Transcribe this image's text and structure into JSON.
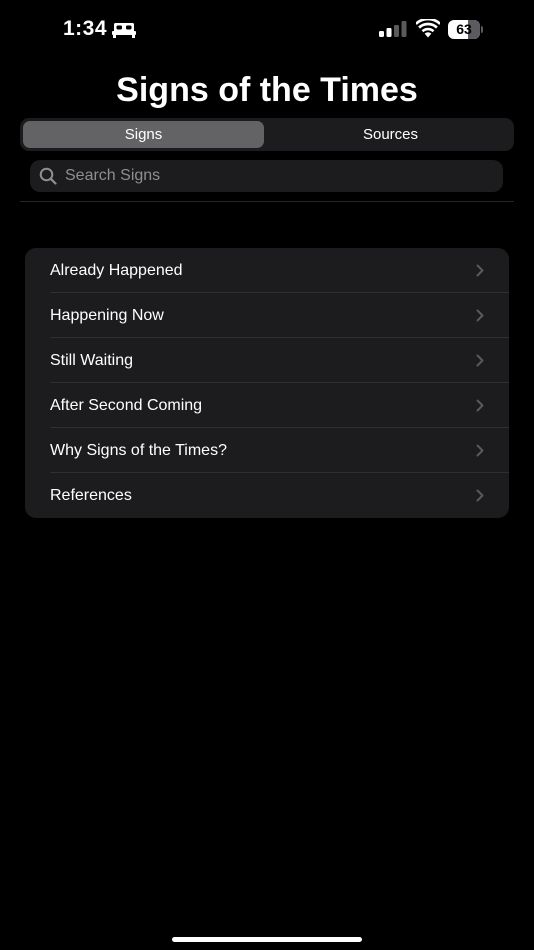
{
  "status_bar": {
    "time": "1:34",
    "battery_level": "63",
    "icons": [
      "sleep-focus-icon",
      "cellular-signal-icon",
      "wifi-icon",
      "battery-icon"
    ]
  },
  "title": "Signs of the Times",
  "segmented_control": {
    "segments": [
      {
        "label": "Signs",
        "selected": true
      },
      {
        "label": "Sources",
        "selected": false
      }
    ]
  },
  "search": {
    "placeholder": "Search Signs",
    "value": ""
  },
  "list": {
    "items": [
      {
        "label": "Already Happened"
      },
      {
        "label": "Happening Now"
      },
      {
        "label": "Still Waiting"
      },
      {
        "label": "After Second Coming"
      },
      {
        "label": "Why Signs of the Times?"
      },
      {
        "label": "References"
      }
    ]
  },
  "colors": {
    "background": "#000000",
    "grouped_background": "#1c1c1e",
    "selected_segment": "#636366",
    "secondary_text": "#8e8e93",
    "chevron": "#5a5a5e"
  }
}
